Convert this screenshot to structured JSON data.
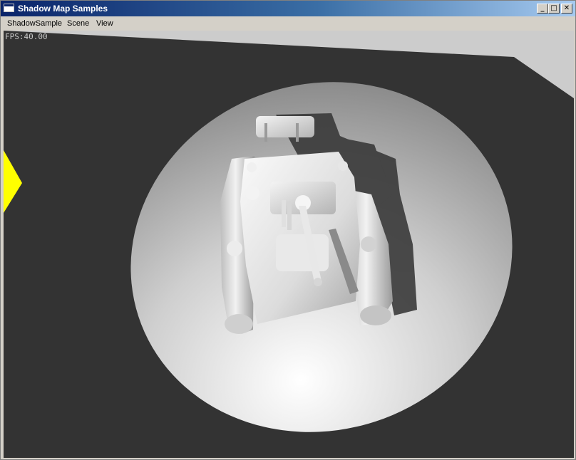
{
  "window": {
    "title": "Shadow Map Samples",
    "buttons": {
      "minimize": "_",
      "maximize": "□",
      "close": "✕"
    }
  },
  "menu": {
    "items": [
      {
        "label": "ShadowSample",
        "id": "shadowsample"
      },
      {
        "label": "Scene",
        "id": "scene"
      },
      {
        "label": "View",
        "id": "view"
      }
    ]
  },
  "viewport": {
    "fps_text": "FPS:40.00"
  },
  "colors": {
    "title_gradient_start": "#0a246a",
    "title_gradient_end": "#a6caf0",
    "scene_background": "#333333",
    "floor_far": "#cccccc",
    "spotlight_center": "#ffffff",
    "spotlight_edge": "#808080",
    "marker_yellow": "#ffff00"
  }
}
